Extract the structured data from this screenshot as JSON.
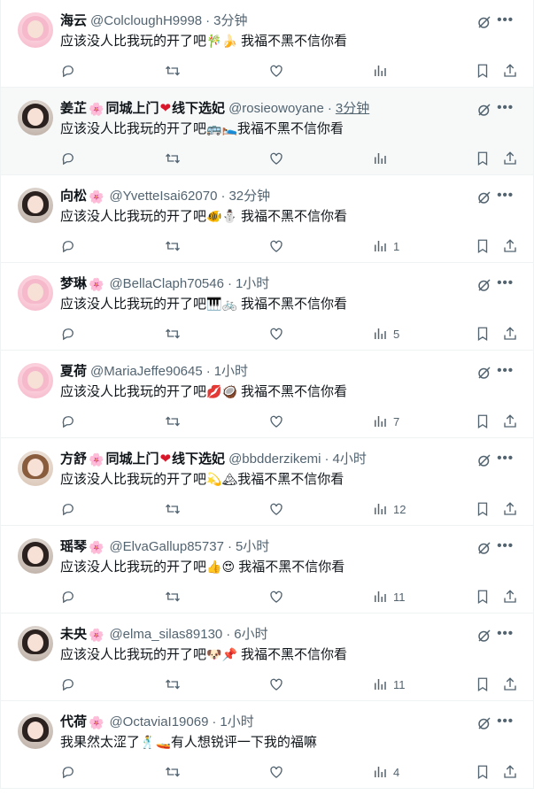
{
  "feed": {
    "tweets": [
      {
        "name": "海云",
        "badge": "",
        "tag": "",
        "handle": "@ColcloughH9998",
        "time": "3分钟",
        "text_before": "应该没人比我玩的开了吧",
        "emoji": "🎋🍌",
        "text_after": " 我福不黑不信你看",
        "views": "",
        "avatar": "pink-avatar"
      },
      {
        "name": "姜芷",
        "badge": "🌸",
        "tag": "同城上门",
        "heart": "❤",
        "tag2": "线下选妃",
        "handle": "@rosieowoyane",
        "time": "3分钟",
        "text_before": "应该没人比我玩的开了吧",
        "emoji": "🚌🛌",
        "text_after": "我福不黑不信你看",
        "views": "",
        "avatar": "dark-avatar"
      },
      {
        "name": "向松",
        "badge": "🌸",
        "tag": "",
        "handle": "@YvetteIsai62070",
        "time": "32分钟",
        "text_before": "应该没人比我玩的开了吧",
        "emoji": "🐠⛄",
        "text_after": " 我福不黑不信你看",
        "views": "1",
        "avatar": "dark-avatar"
      },
      {
        "name": "梦琳",
        "badge": "🌸",
        "tag": "",
        "handle": "@BellaClaph70546",
        "time": "1小时",
        "text_before": "应该没人比我玩的开了吧",
        "emoji": "🎹🚲",
        "text_after": " 我福不黑不信你看",
        "views": "5",
        "avatar": "pink-avatar"
      },
      {
        "name": "夏荷",
        "badge": "",
        "tag": "",
        "handle": "@MariaJeffe90645",
        "time": "1小时",
        "text_before": "应该没人比我玩的开了吧",
        "emoji": "💋🥥",
        "text_after": " 我福不黑不信你看",
        "views": "7",
        "avatar": "pink-avatar"
      },
      {
        "name": "方舒",
        "badge": "🌸",
        "tag": "同城上门",
        "heart": "❤",
        "tag2": "线下选妃",
        "handle": "@bbdderzikemi",
        "time": "4小时",
        "text_before": "应该没人比我玩的开了吧",
        "emoji": "💫🏔",
        "text_after": "我福不黑不信你看",
        "views": "12",
        "avatar": "brown-avatar"
      },
      {
        "name": "瑶琴",
        "badge": "🌸",
        "tag": "",
        "handle": "@ElvaGallup85737",
        "time": "5小时",
        "text_before": "应该没人比我玩的开了吧",
        "emoji": "👍😍",
        "text_after": " 我福不黑不信你看",
        "views": "11",
        "avatar": "dark-avatar"
      },
      {
        "name": "未央",
        "badge": "🌸",
        "tag": "",
        "handle": "@elma_silas89130",
        "time": "6小时",
        "text_before": "应该没人比我玩的开了吧",
        "emoji": "🐶📌",
        "text_after": " 我福不黑不信你看",
        "views": "11",
        "avatar": "dark-avatar"
      },
      {
        "name": "代荷",
        "badge": "🌸",
        "tag": "",
        "handle": "@OctaviaI19069",
        "time": "1小时",
        "text_before": "我果然太涩了",
        "emoji": "🕺🚤",
        "text_after": "有人想锐评一下我的福嘛",
        "views": "4",
        "avatar": "dark-avatar"
      }
    ],
    "more_label": "•••",
    "separator": "·"
  }
}
